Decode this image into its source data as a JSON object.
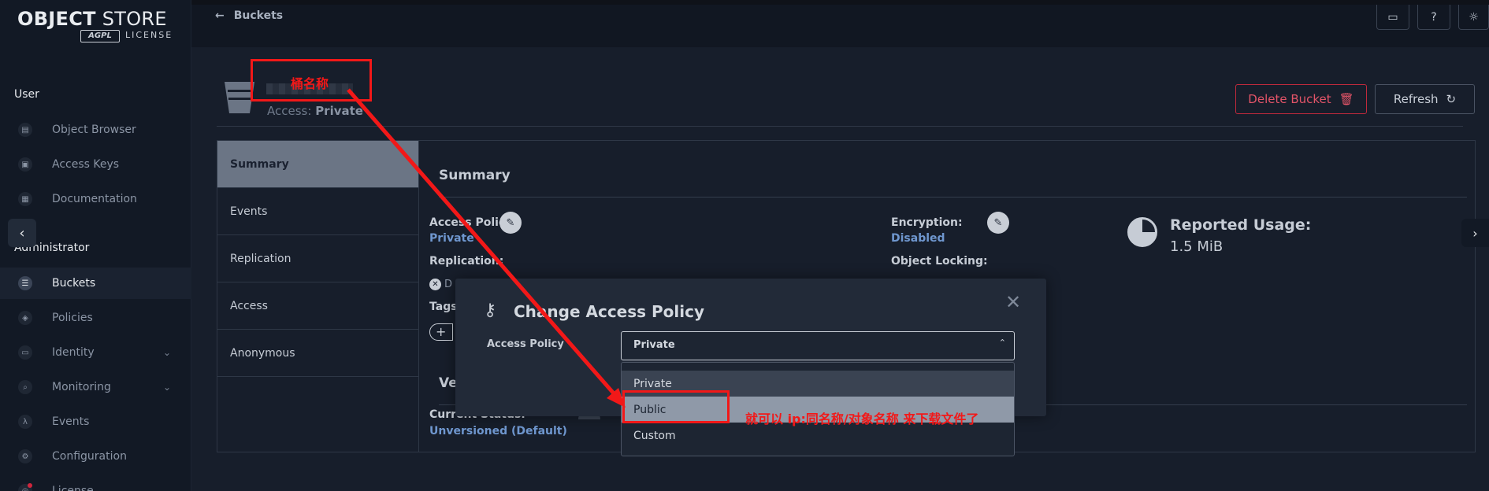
{
  "logo": {
    "word1": "OBJECT",
    "word2": "STORE",
    "badge": "AGPL",
    "license": "LICENSE"
  },
  "sidebar": {
    "section_user": "User",
    "section_admin": "Administrator",
    "items": [
      {
        "label": "Object Browser"
      },
      {
        "label": "Access Keys"
      },
      {
        "label": "Documentation"
      },
      {
        "label": "Buckets"
      },
      {
        "label": "Policies"
      },
      {
        "label": "Identity"
      },
      {
        "label": "Monitoring"
      },
      {
        "label": "Events"
      },
      {
        "label": "Configuration"
      },
      {
        "label": "License"
      }
    ]
  },
  "header": {
    "back_arrow": "←",
    "breadcrumb": "Buckets"
  },
  "bucket": {
    "access_label": "Access:",
    "access_value": "Private"
  },
  "actions": {
    "delete_label": "Delete Bucket",
    "refresh_label": "Refresh"
  },
  "tabs": [
    "Summary",
    "Events",
    "Replication",
    "Access",
    "Anonymous"
  ],
  "summary": {
    "title": "Summary",
    "access_policy_label": "Access Policy:",
    "access_policy_value": "Private",
    "replication_label": "Replication:",
    "replication_value": "D",
    "tags_label": "Tags",
    "encryption_label": "Encryption:",
    "encryption_value": "Disabled",
    "object_locking_label": "Object Locking:",
    "reported_usage_label": "Reported Usage:",
    "reported_usage_value": "1.5 MiB",
    "versioning_title": "Ve",
    "current_status_label": "Current Status:",
    "current_status_value": "Unversioned (Default)"
  },
  "modal": {
    "title": "Change Access Policy",
    "field_label": "Access Policy",
    "selected": "Private",
    "options": [
      "Private",
      "Public",
      "Custom"
    ]
  },
  "annotations": {
    "bucket_name": "桶名称",
    "public_hint": "就可以 ip:同名称/对象名称  来下载文件了"
  },
  "colors": {
    "annotation": "#f21818",
    "link": "#6f97cf",
    "danger": "#e35468"
  }
}
